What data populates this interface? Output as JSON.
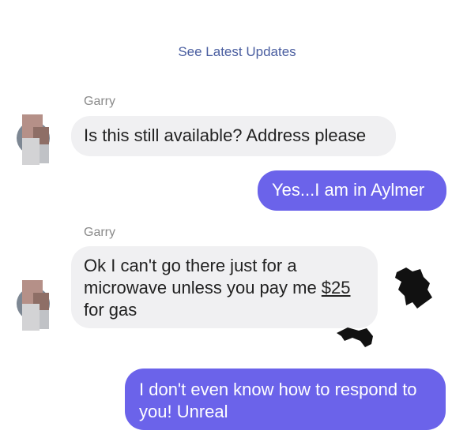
{
  "thread": {
    "updates_link": "See Latest Updates"
  },
  "messages": [
    {
      "sender": "Garry",
      "text": "Is this still available? Address please"
    },
    {
      "text": "Yes...I am in Aylmer"
    },
    {
      "sender": "Garry",
      "text_before": "Ok I can't go there just for a microwave unless you pay me ",
      "amount": "$25",
      "text_after": " for gas"
    },
    {
      "text": "I don't even know how to respond to you! Unreal"
    }
  ],
  "colors": {
    "outgoing_bubble": "#6b63ea",
    "incoming_bubble": "#f0f0f2",
    "link": "#4a5ea0"
  }
}
